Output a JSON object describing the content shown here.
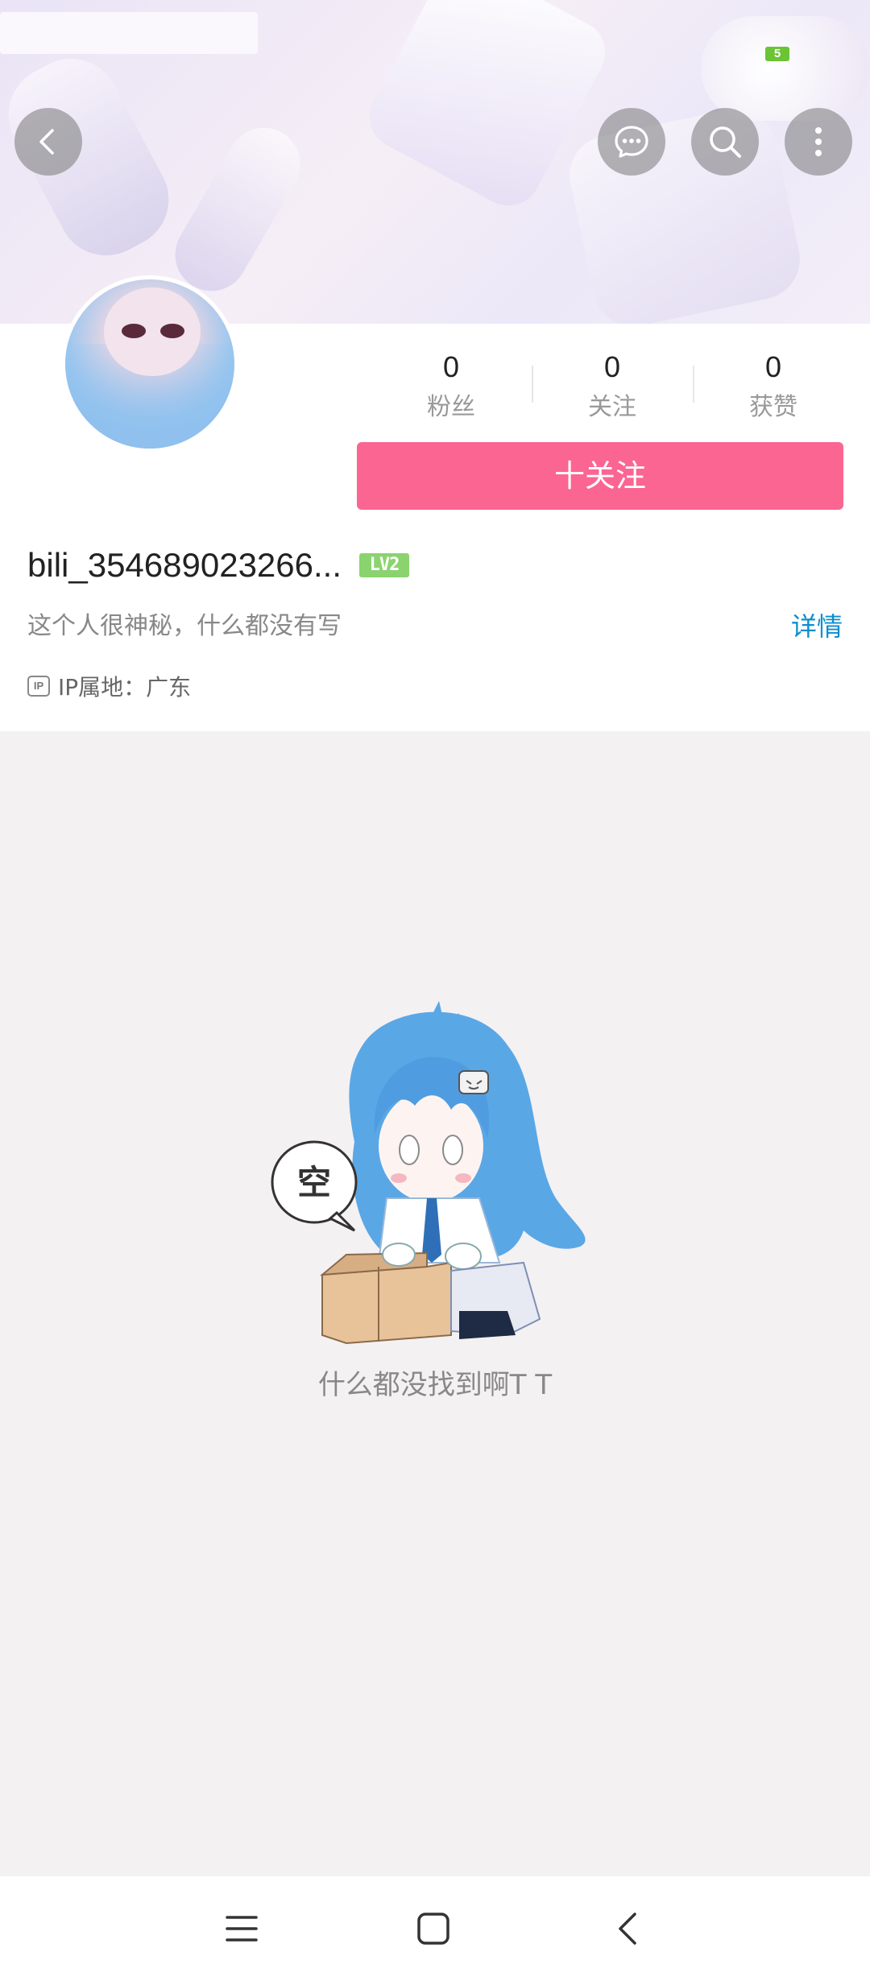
{
  "status": {
    "battery": "5"
  },
  "header": {
    "back_icon": "chevron-left-icon",
    "message_icon": "chat-bubble-icon",
    "search_icon": "search-icon",
    "more_icon": "more-vertical-icon"
  },
  "profile": {
    "stats": [
      {
        "value": "0",
        "label": "粉丝"
      },
      {
        "value": "0",
        "label": "关注"
      },
      {
        "value": "0",
        "label": "获赞"
      }
    ],
    "follow_label": "十关注",
    "username": "bili_354689023266...",
    "level_badge": "LV2",
    "bio": "这个人很神秘，什么都没有写",
    "detail_label": "详情",
    "ip_icon_text": "IP",
    "ip_location": "IP属地：广东"
  },
  "empty_state": {
    "bubble_text": "空",
    "message": "什么都没找到啊T T"
  },
  "colors": {
    "accent_pink": "#fb6592",
    "link_blue": "#0c8ece",
    "level_green": "#8bd36f"
  },
  "navbar": {
    "menu_icon": "menu-icon",
    "home_icon": "home-square-icon",
    "back_icon": "back-chevron-icon"
  }
}
